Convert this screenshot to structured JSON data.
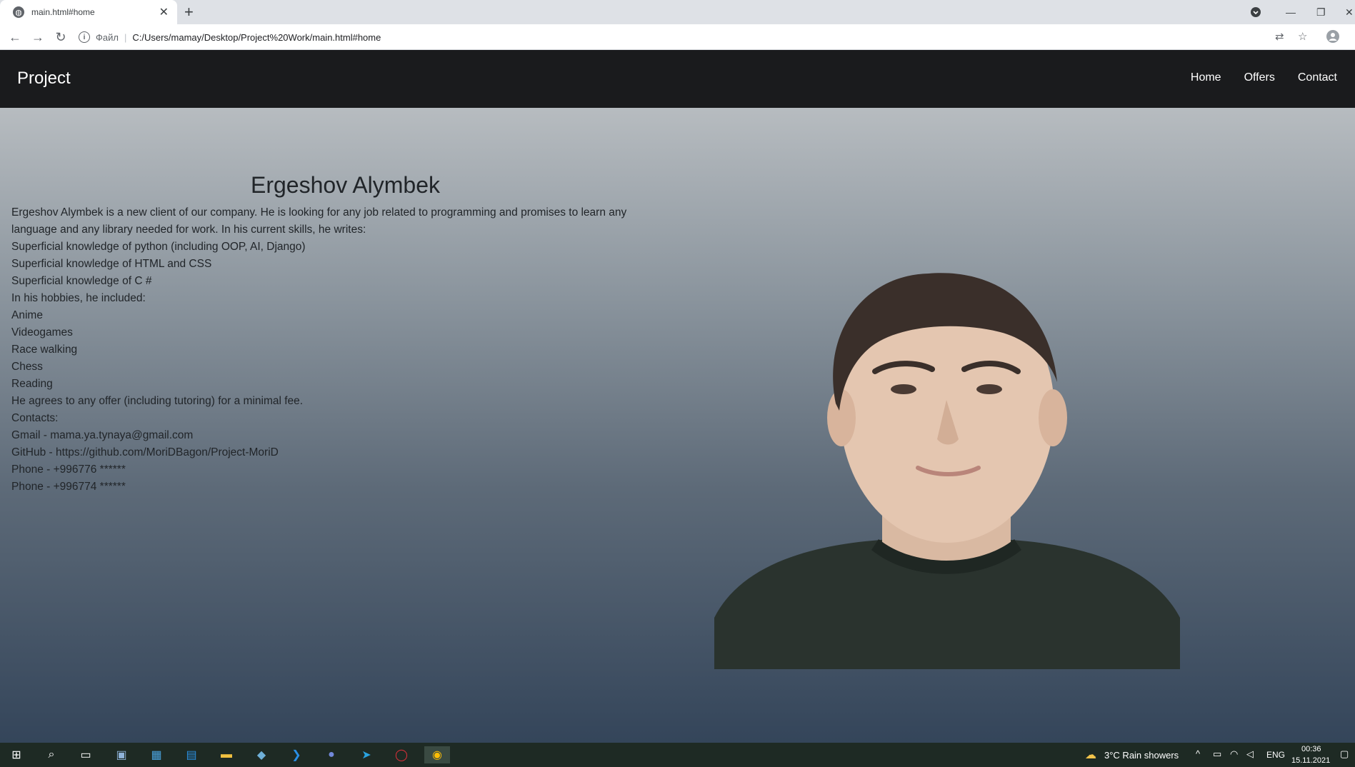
{
  "browser": {
    "tab_title": "main.html#home",
    "proto_label": "Файл",
    "url": "C:/Users/mamay/Desktop/Project%20Work/main.html#home"
  },
  "site": {
    "brand": "Project",
    "nav": [
      "Home",
      "Offers",
      "Contact"
    ]
  },
  "profile": {
    "name": "Ergeshov Alymbek",
    "lines": [
      "Ergeshov Alymbek is a new client of our company. He is looking for any job related to programming and promises to learn any language and any library needed for work. In his current skills, he writes:",
      "Superficial knowledge of python (including OOP, AI, Django)",
      "Superficial knowledge of HTML and CSS",
      "Superficial knowledge of C #",
      "In his hobbies, he included:",
      "Anime",
      "Videogames",
      "Race walking",
      "Chess",
      "Reading",
      "He agrees to any offer (including tutoring) for a minimal fee.",
      "Contacts:",
      "Gmail - mama.ya.tynaya@gmail.com",
      "GitHub - https://github.com/MoriDBagon/Project-MoriD",
      "Phone - +996776 ******",
      "Phone - +996774 ******"
    ]
  },
  "taskbar": {
    "weather": "3°C  Rain showers",
    "lang": "ENG",
    "time": "00:36",
    "date": "15.11.2021"
  },
  "colors": {
    "navbar": "#1a1b1d",
    "text": "#212529",
    "taskbar": "#1e2a24"
  }
}
